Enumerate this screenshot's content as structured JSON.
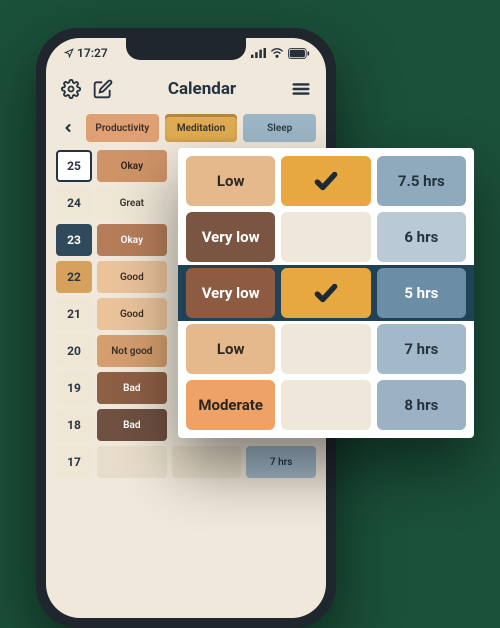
{
  "status": {
    "time": "17:27"
  },
  "header": {
    "title": "Calendar"
  },
  "tabs": {
    "productivity": "Productivity",
    "meditation": "Meditation",
    "sleep": "Sleep"
  },
  "calendar": {
    "rows": [
      {
        "date": "25",
        "prod": "Okay"
      },
      {
        "date": "24",
        "prod": "Great"
      },
      {
        "date": "23",
        "prod": "Okay"
      },
      {
        "date": "22",
        "prod": "Good"
      },
      {
        "date": "21",
        "prod": "Good"
      },
      {
        "date": "20",
        "prod": "Not good"
      },
      {
        "date": "19",
        "prod": "Bad"
      },
      {
        "date": "18",
        "prod": "Bad"
      },
      {
        "date": "17",
        "prod": "",
        "sleep": "7 hrs"
      }
    ]
  },
  "overlay": {
    "rows": [
      {
        "prod": "Low",
        "med_checked": true,
        "sleep": "7.5 hrs"
      },
      {
        "prod": "Very low",
        "med_checked": false,
        "sleep": "6 hrs"
      },
      {
        "prod": "Very low",
        "med_checked": true,
        "sleep": "5 hrs",
        "selected": true
      },
      {
        "prod": "Low",
        "med_checked": false,
        "sleep": "7 hrs"
      },
      {
        "prod": "Moderate",
        "med_checked": false,
        "sleep": "8 hrs"
      }
    ]
  },
  "colors": {
    "accent_orange": "#e6a83f",
    "accent_navy": "#1f4256",
    "bg_cream": "#f0e8da"
  }
}
